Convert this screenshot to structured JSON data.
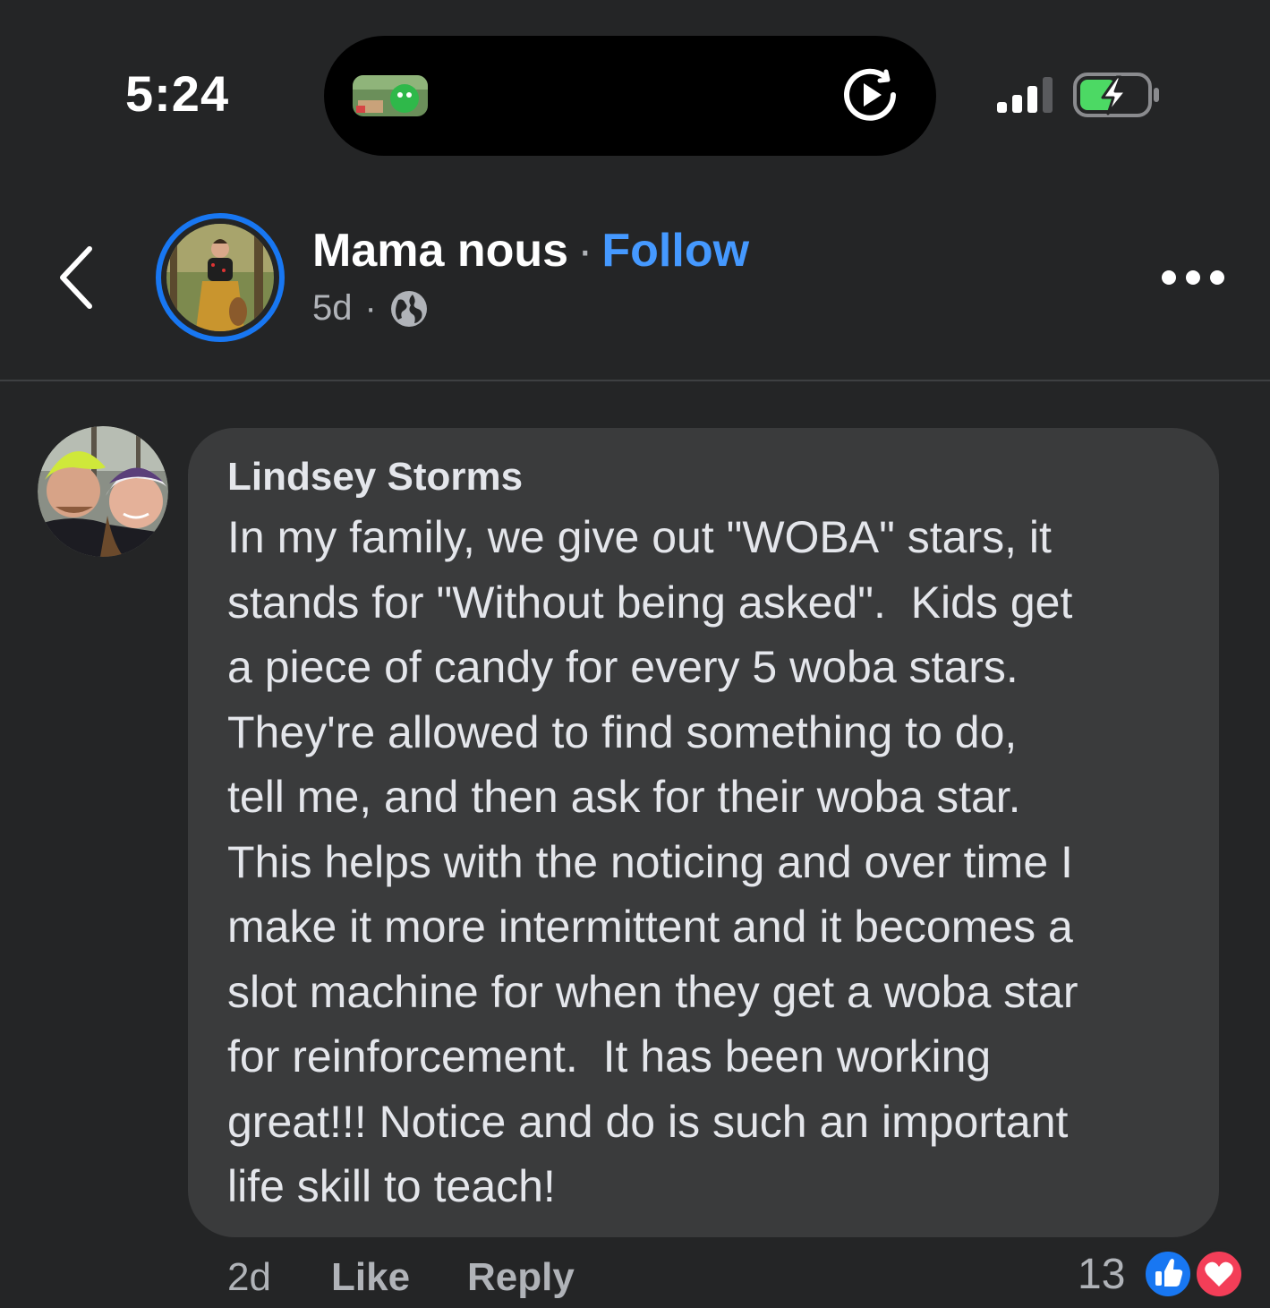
{
  "status_bar": {
    "time": "5:24"
  },
  "header": {
    "page_name": "Mama nous",
    "separator": "·",
    "follow_label": "Follow",
    "age": "5d",
    "meta_separator": "·",
    "privacy_icon": "globe-icon",
    "back_icon": "chevron-left-icon",
    "more_icon": "more-horizontal-icon"
  },
  "comment": {
    "author": "Lindsey Storms",
    "text_lines": [
      "In my family, we give out \"WOBA\" stars, it",
      "stands for \"Without being asked\".  Kids get",
      "a piece of candy for every 5 woba stars.",
      "They're allowed to find something to do,",
      "tell me, and then ask for their woba star.",
      "This helps with the noticing and over time I",
      "make it more intermittent and it becomes a",
      "slot machine for when they get a woba star",
      "for reinforcement.  It has been working",
      "great!!! Notice and do is such an important",
      "life skill to teach!"
    ],
    "time": "2d",
    "like_label": "Like",
    "reply_label": "Reply",
    "reaction_count": "13",
    "reactions": [
      "like-icon",
      "love-icon"
    ]
  },
  "colors": {
    "background": "#242526",
    "bubble": "#3a3b3c",
    "follow": "#4599ff",
    "avatar_ring": "#1877f2",
    "battery_green": "#4cd964",
    "like_blue": "#1877f2",
    "love_red": "#f33e58"
  }
}
